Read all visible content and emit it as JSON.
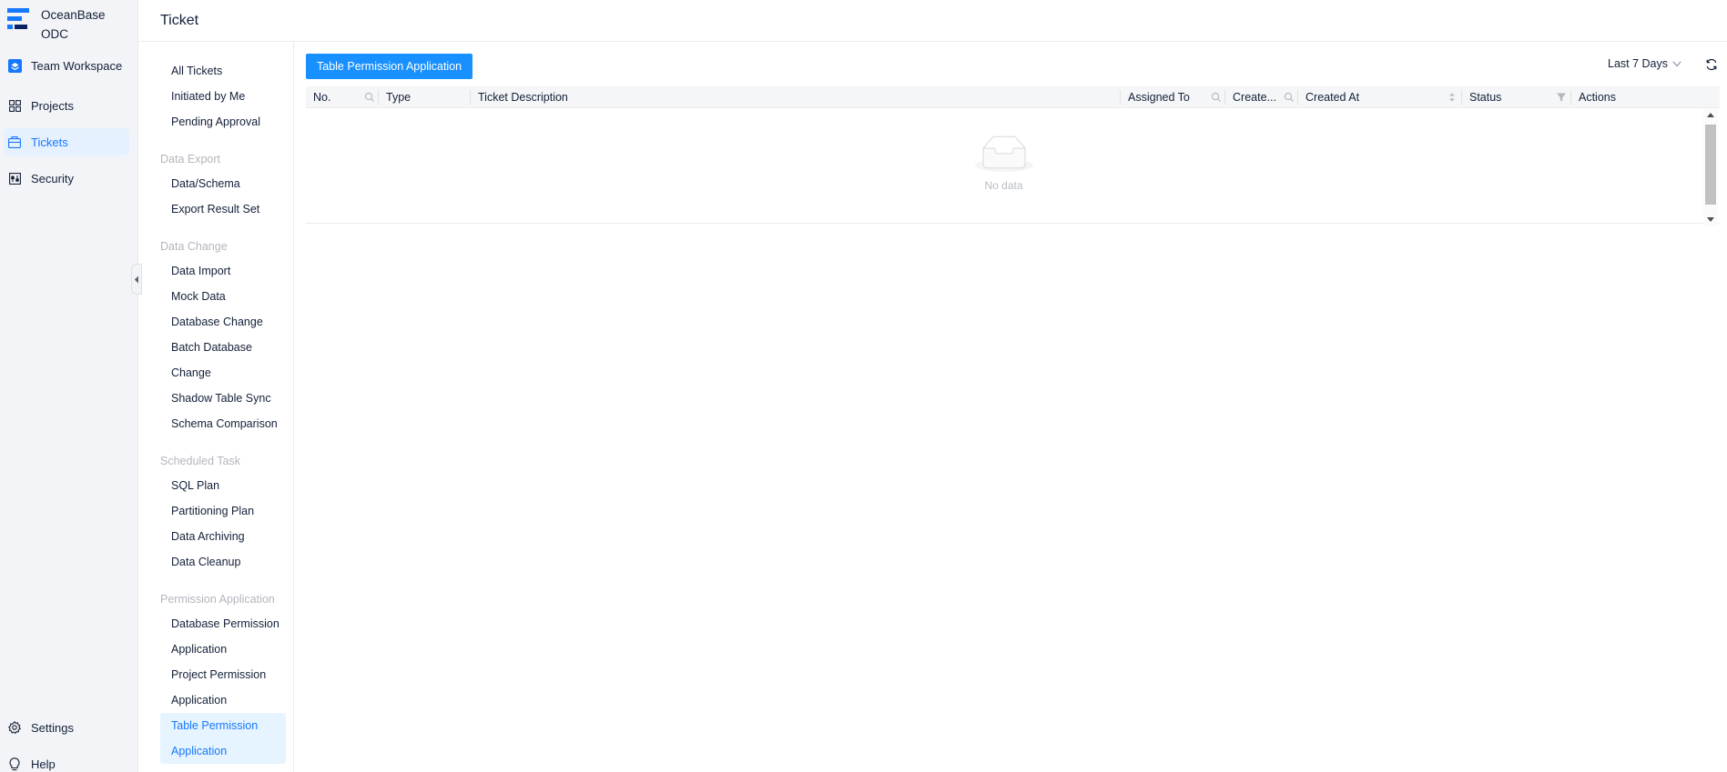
{
  "brand": {
    "line1": "OceanBase",
    "line2": "ODC",
    "accent": "#1677ff"
  },
  "global_nav": {
    "workspace": "Team Workspace",
    "items": [
      {
        "label": "Projects",
        "icon": "grid-icon"
      },
      {
        "label": "Tickets",
        "icon": "ticket-icon",
        "active": true
      },
      {
        "label": "Security",
        "icon": "security-icon"
      }
    ],
    "bottom": [
      {
        "label": "Settings",
        "icon": "gear-icon"
      },
      {
        "label": "Help",
        "icon": "lightbulb-icon"
      }
    ]
  },
  "page": {
    "title": "Ticket"
  },
  "ticket_menu": {
    "top": [
      "All Tickets",
      "Initiated by Me",
      "Pending Approval"
    ],
    "groups": [
      {
        "title": "Data Export",
        "items": [
          "Data/Schema",
          "Export Result Set"
        ]
      },
      {
        "title": "Data Change",
        "items": [
          "Data Import",
          "Mock Data",
          "Database Change",
          "Batch Database",
          "Change",
          "Shadow Table Sync",
          "Schema Comparison"
        ]
      },
      {
        "title": "Scheduled Task",
        "items": [
          "SQL Plan",
          "Partitioning Plan",
          "Data Archiving",
          "Data Cleanup"
        ]
      },
      {
        "title": "Permission Application",
        "items": [
          "Database Permission",
          "Application",
          "Project Permission",
          "Application",
          "Table Permission",
          "Application"
        ]
      }
    ]
  },
  "toolbar": {
    "create_button": "Table Permission Application",
    "date_filter": "Last 7 Days"
  },
  "table": {
    "columns": [
      "No.",
      "Type",
      "Ticket Description",
      "Assigned To",
      "Create...",
      "Created At",
      "Status",
      "Actions"
    ],
    "empty_text": "No data"
  }
}
